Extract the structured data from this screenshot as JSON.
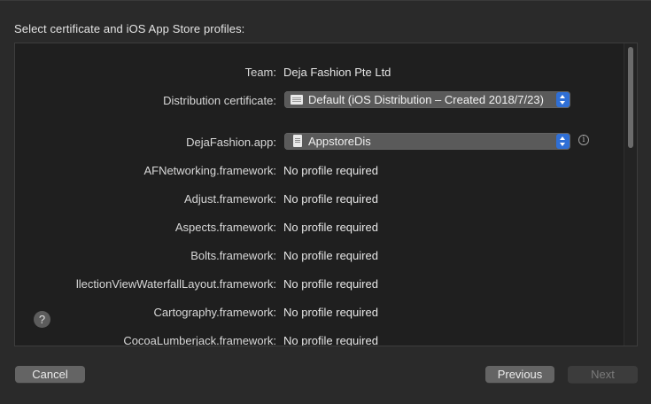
{
  "sheet": {
    "title": "Select certificate and iOS App Store profiles:"
  },
  "rows": [
    {
      "label": "Team:",
      "value": "Deja Fashion Pte Ltd"
    },
    {
      "label": "Distribution certificate:",
      "popup": "Default (iOS Distribution – Created 2018/7/23)",
      "icon": "certificate-icon"
    },
    {
      "label": "DejaFashion.app:",
      "popup": "AppstoreDis",
      "icon": "profile-document-icon",
      "info_icon": "info-icon"
    },
    {
      "label": "AFNetworking.framework:",
      "value": "No profile required"
    },
    {
      "label": "Adjust.framework:",
      "value": "No profile required"
    },
    {
      "label": "Aspects.framework:",
      "value": "No profile required"
    },
    {
      "label": "Bolts.framework:",
      "value": "No profile required"
    },
    {
      "label": "llectionViewWaterfallLayout.framework:",
      "value": "No profile required"
    },
    {
      "label": "Cartography.framework:",
      "value": "No profile required"
    },
    {
      "label": "CocoaLumberjack.framework:",
      "value": "No profile required"
    }
  ],
  "help": {
    "label": "?"
  },
  "buttons": {
    "cancel": "Cancel",
    "previous": "Previous",
    "next": "Next"
  },
  "colors": {
    "accent": "#2f6fd6",
    "background": "#2a2a2a",
    "panel": "#1f1f1f"
  }
}
